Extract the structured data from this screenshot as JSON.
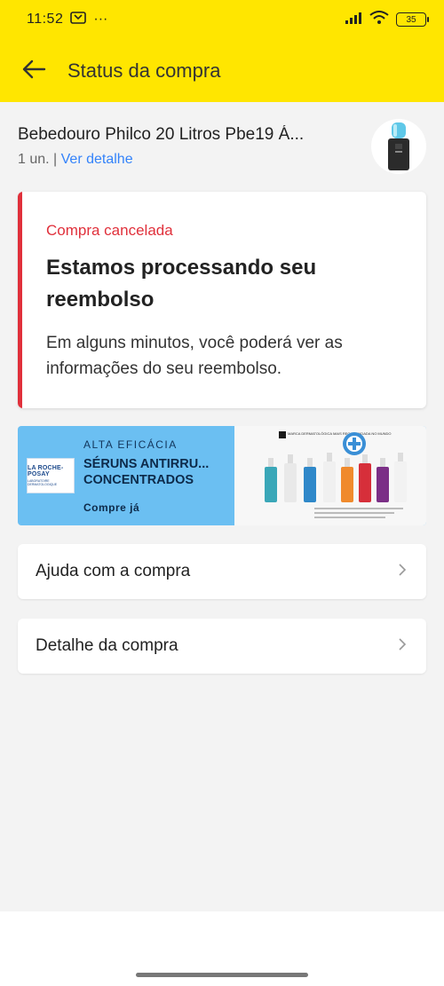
{
  "statusbar": {
    "time": "11:52",
    "dots": "···",
    "battery": "35"
  },
  "header": {
    "title": "Status da compra",
    "color": "#ffe600"
  },
  "product": {
    "name": "Bebedouro Philco 20 Litros Pbe19 Á...",
    "quantity": "1 un. | ",
    "detail_link": "Ver detalhe"
  },
  "status": {
    "label": "Compra cancelada",
    "title": "Estamos processando seu reembolso",
    "description": "Em alguns minutos, você poderá ver as informações do seu reembolso.",
    "accent": "#e0303b"
  },
  "banner": {
    "logo_text": "LA ROCHE-POSAY",
    "logo_sub": "LABORATOIRE DERMATOLOGIQUE",
    "eyebrow": "ALTA EFICÁCIA",
    "headline": "SÉRUNS ANTIRRU... CONCENTRADOS",
    "cta": "Compre já",
    "right_badge": "MARCA DERMATOLÓGICA MAIS RECOMENDADA NO MUNDO"
  },
  "actions": [
    {
      "label": "Ajuda com a compra"
    },
    {
      "label": "Detalhe da compra"
    }
  ]
}
